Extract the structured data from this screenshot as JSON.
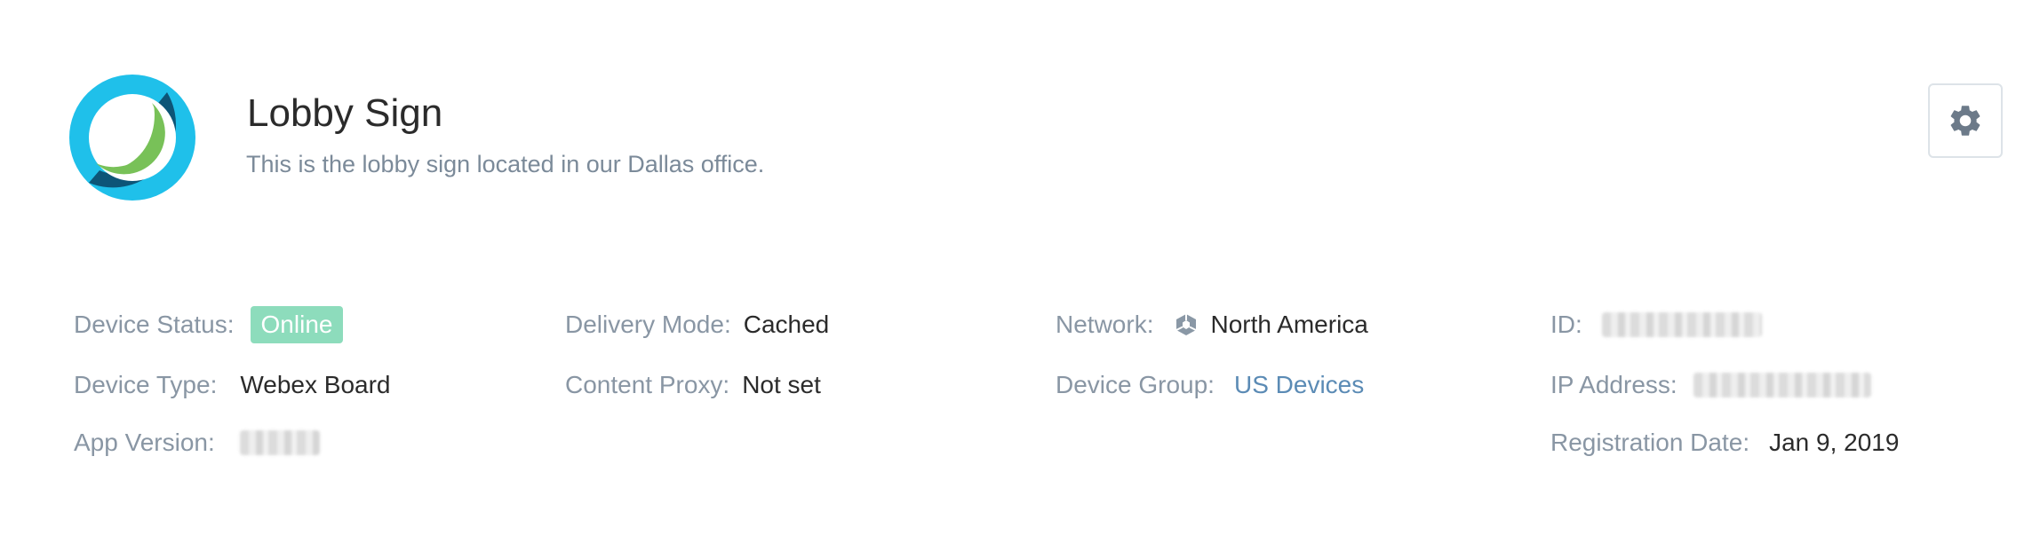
{
  "device": {
    "name": "Lobby Sign",
    "description": "This is the lobby sign located in our Dallas office."
  },
  "header": {
    "settings_icon": "gear-icon"
  },
  "fields": {
    "device_status": {
      "label": "Device Status:",
      "value": "Online"
    },
    "device_type": {
      "label": "Device Type:",
      "value": "Webex Board"
    },
    "app_version": {
      "label": "App Version:"
    },
    "delivery_mode": {
      "label": "Delivery Mode:",
      "value": "Cached"
    },
    "content_proxy": {
      "label": "Content Proxy:",
      "value": "Not set"
    },
    "network": {
      "label": "Network:",
      "value": "North America",
      "icon": "network-icon"
    },
    "device_group": {
      "label": "Device Group:",
      "value": "US Devices"
    },
    "id": {
      "label": "ID:"
    },
    "ip_address": {
      "label": "IP Address:"
    },
    "registration_date": {
      "label": "Registration Date:",
      "value": "Jan 9, 2019"
    }
  },
  "colors": {
    "online_badge": "#8ddcbc",
    "link": "#5b8bb5",
    "label": "#8996a4",
    "logo_blue": "#1fc0ea",
    "logo_dark": "#0d5577",
    "logo_green": "#78c158"
  }
}
